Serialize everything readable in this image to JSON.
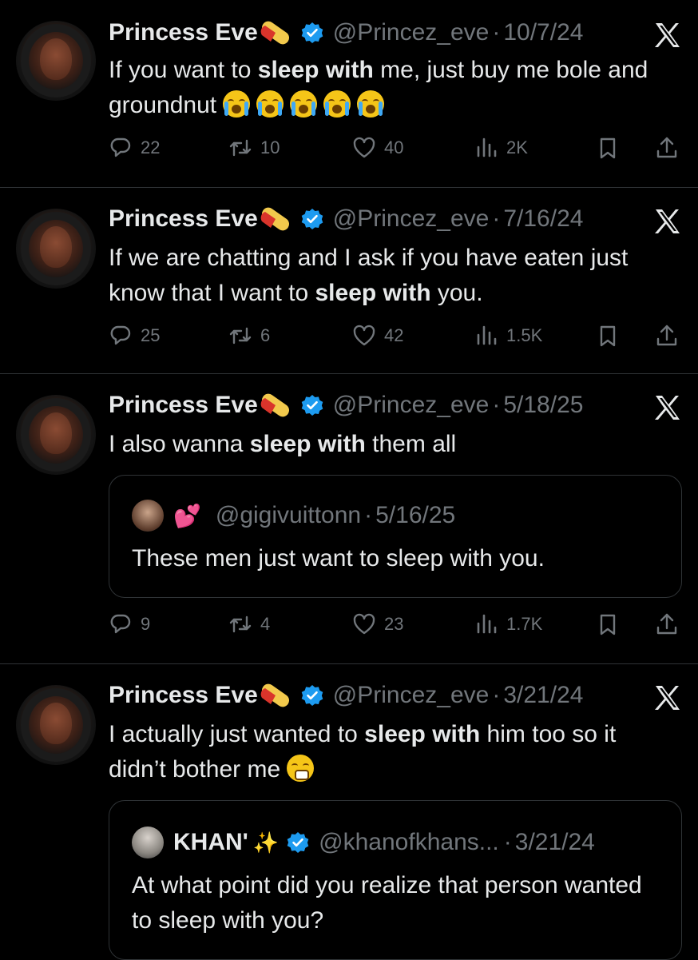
{
  "colors": {
    "background": "#000000",
    "text": "#e7e9ea",
    "muted": "#71767b",
    "verified": "#1d9bf0",
    "divider": "#2f3336"
  },
  "tweets": [
    {
      "name": "Princess Eve",
      "name_emoji": "pill-emoji",
      "handle": "@Princez_eve",
      "date": "10/7/24",
      "text_parts": [
        "If you want to ",
        "sleep with",
        " me, just buy me bole and groundnut "
      ],
      "emojis": [
        "loudly-crying-face",
        "loudly-crying-face",
        "loudly-crying-face",
        "loudly-crying-face",
        "loudly-crying-face"
      ],
      "replies": "22",
      "retweets": "10",
      "likes": "40",
      "views": "2K"
    },
    {
      "name": "Princess Eve",
      "name_emoji": "pill-emoji",
      "handle": "@Princez_eve",
      "date": "7/16/24",
      "text_parts": [
        "If we are chatting and I ask if you have eaten just know that I want to ",
        "sleep with",
        " you."
      ],
      "replies": "25",
      "retweets": "6",
      "likes": "42",
      "views": "1.5K"
    },
    {
      "name": "Princess Eve",
      "name_emoji": "pill-emoji",
      "handle": "@Princez_eve",
      "date": "5/18/25",
      "text_parts": [
        "I also wanna ",
        "sleep with",
        " them all"
      ],
      "quote": {
        "name_emoji": "two-hearts-emoji",
        "handle": "@gigivuittonn",
        "date": "5/16/25",
        "text": "These men just want to sleep with you."
      },
      "replies": "9",
      "retweets": "4",
      "likes": "23",
      "views": "1.7K"
    },
    {
      "name": "Princess Eve",
      "name_emoji": "pill-emoji",
      "handle": "@Princez_eve",
      "date": "3/21/24",
      "text_parts": [
        "I actually just wanted to ",
        "sleep with",
        " him too so it didn’t bother me "
      ],
      "emojis": [
        "sneezing-face"
      ],
      "quote": {
        "name": "KHAN'",
        "name_emoji": "sparkles-emoji",
        "handle": "@khanofkhans...",
        "date": "3/21/24",
        "text": "At what point did you realize that person wanted to sleep with you?"
      }
    }
  ],
  "separator": "·"
}
